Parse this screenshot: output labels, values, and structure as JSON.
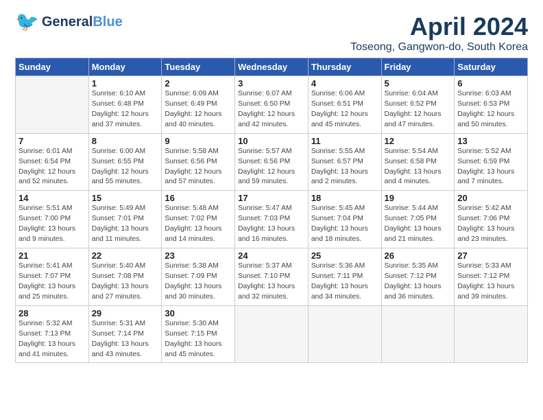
{
  "header": {
    "logo_general": "General",
    "logo_blue": "Blue",
    "title": "April 2024",
    "subtitle": "Toseong, Gangwon-do, South Korea"
  },
  "weekdays": [
    "Sunday",
    "Monday",
    "Tuesday",
    "Wednesday",
    "Thursday",
    "Friday",
    "Saturday"
  ],
  "weeks": [
    [
      {
        "day": "",
        "detail": ""
      },
      {
        "day": "1",
        "detail": "Sunrise: 6:10 AM\nSunset: 6:48 PM\nDaylight: 12 hours\nand 37 minutes."
      },
      {
        "day": "2",
        "detail": "Sunrise: 6:09 AM\nSunset: 6:49 PM\nDaylight: 12 hours\nand 40 minutes."
      },
      {
        "day": "3",
        "detail": "Sunrise: 6:07 AM\nSunset: 6:50 PM\nDaylight: 12 hours\nand 42 minutes."
      },
      {
        "day": "4",
        "detail": "Sunrise: 6:06 AM\nSunset: 6:51 PM\nDaylight: 12 hours\nand 45 minutes."
      },
      {
        "day": "5",
        "detail": "Sunrise: 6:04 AM\nSunset: 6:52 PM\nDaylight: 12 hours\nand 47 minutes."
      },
      {
        "day": "6",
        "detail": "Sunrise: 6:03 AM\nSunset: 6:53 PM\nDaylight: 12 hours\nand 50 minutes."
      }
    ],
    [
      {
        "day": "7",
        "detail": "Sunrise: 6:01 AM\nSunset: 6:54 PM\nDaylight: 12 hours\nand 52 minutes."
      },
      {
        "day": "8",
        "detail": "Sunrise: 6:00 AM\nSunset: 6:55 PM\nDaylight: 12 hours\nand 55 minutes."
      },
      {
        "day": "9",
        "detail": "Sunrise: 5:58 AM\nSunset: 6:56 PM\nDaylight: 12 hours\nand 57 minutes."
      },
      {
        "day": "10",
        "detail": "Sunrise: 5:57 AM\nSunset: 6:56 PM\nDaylight: 12 hours\nand 59 minutes."
      },
      {
        "day": "11",
        "detail": "Sunrise: 5:55 AM\nSunset: 6:57 PM\nDaylight: 13 hours\nand 2 minutes."
      },
      {
        "day": "12",
        "detail": "Sunrise: 5:54 AM\nSunset: 6:58 PM\nDaylight: 13 hours\nand 4 minutes."
      },
      {
        "day": "13",
        "detail": "Sunrise: 5:52 AM\nSunset: 6:59 PM\nDaylight: 13 hours\nand 7 minutes."
      }
    ],
    [
      {
        "day": "14",
        "detail": "Sunrise: 5:51 AM\nSunset: 7:00 PM\nDaylight: 13 hours\nand 9 minutes."
      },
      {
        "day": "15",
        "detail": "Sunrise: 5:49 AM\nSunset: 7:01 PM\nDaylight: 13 hours\nand 11 minutes."
      },
      {
        "day": "16",
        "detail": "Sunrise: 5:48 AM\nSunset: 7:02 PM\nDaylight: 13 hours\nand 14 minutes."
      },
      {
        "day": "17",
        "detail": "Sunrise: 5:47 AM\nSunset: 7:03 PM\nDaylight: 13 hours\nand 16 minutes."
      },
      {
        "day": "18",
        "detail": "Sunrise: 5:45 AM\nSunset: 7:04 PM\nDaylight: 13 hours\nand 18 minutes."
      },
      {
        "day": "19",
        "detail": "Sunrise: 5:44 AM\nSunset: 7:05 PM\nDaylight: 13 hours\nand 21 minutes."
      },
      {
        "day": "20",
        "detail": "Sunrise: 5:42 AM\nSunset: 7:06 PM\nDaylight: 13 hours\nand 23 minutes."
      }
    ],
    [
      {
        "day": "21",
        "detail": "Sunrise: 5:41 AM\nSunset: 7:07 PM\nDaylight: 13 hours\nand 25 minutes."
      },
      {
        "day": "22",
        "detail": "Sunrise: 5:40 AM\nSunset: 7:08 PM\nDaylight: 13 hours\nand 27 minutes."
      },
      {
        "day": "23",
        "detail": "Sunrise: 5:38 AM\nSunset: 7:09 PM\nDaylight: 13 hours\nand 30 minutes."
      },
      {
        "day": "24",
        "detail": "Sunrise: 5:37 AM\nSunset: 7:10 PM\nDaylight: 13 hours\nand 32 minutes."
      },
      {
        "day": "25",
        "detail": "Sunrise: 5:36 AM\nSunset: 7:11 PM\nDaylight: 13 hours\nand 34 minutes."
      },
      {
        "day": "26",
        "detail": "Sunrise: 5:35 AM\nSunset: 7:12 PM\nDaylight: 13 hours\nand 36 minutes."
      },
      {
        "day": "27",
        "detail": "Sunrise: 5:33 AM\nSunset: 7:12 PM\nDaylight: 13 hours\nand 39 minutes."
      }
    ],
    [
      {
        "day": "28",
        "detail": "Sunrise: 5:32 AM\nSunset: 7:13 PM\nDaylight: 13 hours\nand 41 minutes."
      },
      {
        "day": "29",
        "detail": "Sunrise: 5:31 AM\nSunset: 7:14 PM\nDaylight: 13 hours\nand 43 minutes."
      },
      {
        "day": "30",
        "detail": "Sunrise: 5:30 AM\nSunset: 7:15 PM\nDaylight: 13 hours\nand 45 minutes."
      },
      {
        "day": "",
        "detail": ""
      },
      {
        "day": "",
        "detail": ""
      },
      {
        "day": "",
        "detail": ""
      },
      {
        "day": "",
        "detail": ""
      }
    ]
  ]
}
